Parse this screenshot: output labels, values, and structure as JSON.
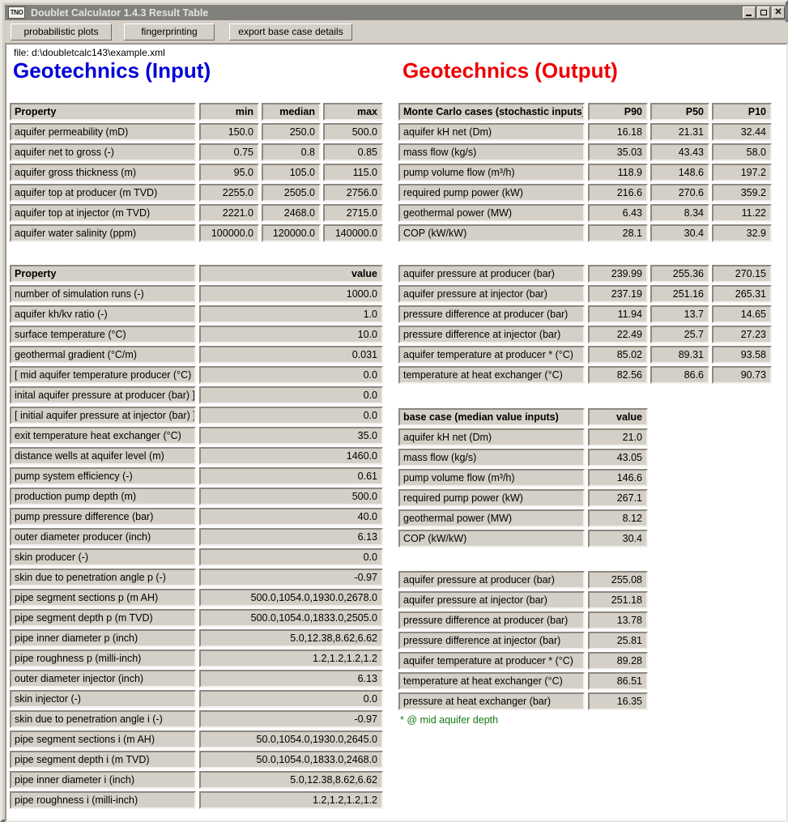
{
  "window": {
    "title": "Doublet Calculator 1.4.3 Result Table",
    "logo": "TNO",
    "minimize": "_",
    "maximize": "❐",
    "close": "✕"
  },
  "toolbar": {
    "probabilistic_plots": "probabilistic plots",
    "fingerprinting": "fingerprinting",
    "export_base_case": "export base case details"
  },
  "file_label": "file: d:\\doubletcalc143\\example.xml",
  "input": {
    "title": "Geotechnics (Input)",
    "stochastic_table": {
      "headers": [
        "Property",
        "min",
        "median",
        "max"
      ],
      "rows": [
        [
          "aquifer permeability (mD)",
          "150.0",
          "250.0",
          "500.0"
        ],
        [
          "aquifer net to gross (-)",
          "0.75",
          "0.8",
          "0.85"
        ],
        [
          "aquifer gross thickness (m)",
          "95.0",
          "105.0",
          "115.0"
        ],
        [
          "aquifer top at producer (m TVD)",
          "2255.0",
          "2505.0",
          "2756.0"
        ],
        [
          "aquifer top at injector (m TVD)",
          "2221.0",
          "2468.0",
          "2715.0"
        ],
        [
          "aquifer water salinity (ppm)",
          "100000.0",
          "120000.0",
          "140000.0"
        ]
      ]
    },
    "deterministic_table": {
      "headers": [
        "Property",
        "value"
      ],
      "rows": [
        [
          "number of simulation runs (-)",
          "1000.0"
        ],
        [
          "aquifer kh/kv ratio (-)",
          "1.0"
        ],
        [
          "surface temperature (°C)",
          "10.0"
        ],
        [
          "geothermal gradient (°C/m)",
          "0.031"
        ],
        [
          "[ mid aquifer temperature producer (°C) ]",
          "0.0"
        ],
        [
          "inital aquifer pressure at producer (bar) ]",
          "0.0"
        ],
        [
          "[ initial aquifer pressure at injector (bar) ]",
          "0.0"
        ],
        [
          "exit temperature heat exchanger (°C)",
          "35.0"
        ],
        [
          "distance wells at aquifer level (m)",
          "1460.0"
        ],
        [
          "pump system efficiency (-)",
          "0.61"
        ],
        [
          "production pump depth (m)",
          "500.0"
        ],
        [
          "pump pressure difference (bar)",
          "40.0"
        ],
        [
          "outer diameter producer (inch)",
          "6.13"
        ],
        [
          "skin producer (-)",
          "0.0"
        ],
        [
          "skin due to penetration angle p (-)",
          "-0.97"
        ],
        [
          "pipe segment sections p (m AH)",
          "500.0,1054.0,1930.0,2678.0"
        ],
        [
          "pipe segment depth p (m TVD)",
          "500.0,1054.0,1833.0,2505.0"
        ],
        [
          "pipe inner diameter p (inch)",
          "5.0,12.38,8.62,6.62"
        ],
        [
          "pipe roughness p (milli-inch)",
          "1.2,1.2,1.2,1.2"
        ],
        [
          "outer diameter injector (inch)",
          "6.13"
        ],
        [
          "skin injector (-)",
          "0.0"
        ],
        [
          "skin due to penetration angle i (-)",
          "-0.97"
        ],
        [
          "pipe segment sections i (m AH)",
          "50.0,1054.0,1930.0,2645.0"
        ],
        [
          "pipe segment depth i (m TVD)",
          "50.0,1054.0,1833.0,2468.0"
        ],
        [
          "pipe inner diameter i  (inch)",
          "5.0,12.38,8.62,6.62"
        ],
        [
          "pipe roughness i (milli-inch)",
          "1.2,1.2,1.2,1.2"
        ]
      ]
    }
  },
  "output": {
    "title": "Geotechnics (Output)",
    "monte_carlo_table": {
      "headers": [
        "Monte Carlo cases (stochastic inputs)",
        "P90",
        "P50",
        "P10"
      ],
      "rows": [
        [
          "aquifer kH net (Dm)",
          "16.18",
          "21.31",
          "32.44"
        ],
        [
          "mass flow (kg/s)",
          "35.03",
          "43.43",
          "58.0"
        ],
        [
          "pump volume flow (m³/h)",
          "118.9",
          "148.6",
          "197.2"
        ],
        [
          "required pump power (kW)",
          "216.6",
          "270.6",
          "359.2"
        ],
        [
          "geothermal power (MW)",
          "6.43",
          "8.34",
          "11.22"
        ],
        [
          "COP (kW/kW)",
          "28.1",
          "30.4",
          "32.9"
        ]
      ]
    },
    "monte_carlo_table2": {
      "rows": [
        [
          "aquifer pressure at producer (bar)",
          "239.99",
          "255.36",
          "270.15"
        ],
        [
          "aquifer pressure at injector (bar)",
          "237.19",
          "251.16",
          "265.31"
        ],
        [
          "pressure difference at producer (bar)",
          "11.94",
          "13.7",
          "14.65"
        ],
        [
          "pressure difference at injector (bar)",
          "22.49",
          "25.7",
          "27.23"
        ],
        [
          "aquifer temperature at producer * (°C)",
          "85.02",
          "89.31",
          "93.58"
        ],
        [
          "temperature at heat exchanger (°C)",
          "82.56",
          "86.6",
          "90.73"
        ]
      ]
    },
    "base_case_table": {
      "headers": [
        "base case (median value inputs)",
        "value"
      ],
      "rows": [
        [
          "aquifer kH net (Dm)",
          "21.0"
        ],
        [
          "mass flow (kg/s)",
          "43.05"
        ],
        [
          "pump volume flow (m³/h)",
          "146.6"
        ],
        [
          "required pump power (kW)",
          "267.1"
        ],
        [
          "geothermal power (MW)",
          "8.12"
        ],
        [
          "COP (kW/kW)",
          "30.4"
        ]
      ]
    },
    "base_case_table2": {
      "rows": [
        [
          "aquifer pressure at producer (bar)",
          "255.08"
        ],
        [
          "aquifer pressure at injector (bar)",
          "251.18"
        ],
        [
          "pressure difference at producer (bar)",
          "13.78"
        ],
        [
          "pressure difference at injector (bar)",
          "25.81"
        ],
        [
          "aquifer temperature at producer * (°C)",
          "89.28"
        ],
        [
          "temperature at heat exchanger (°C)",
          "86.51"
        ],
        [
          "pressure at heat exchanger (bar)",
          "16.35"
        ]
      ]
    },
    "footnote": "* @ mid aquifer depth"
  }
}
